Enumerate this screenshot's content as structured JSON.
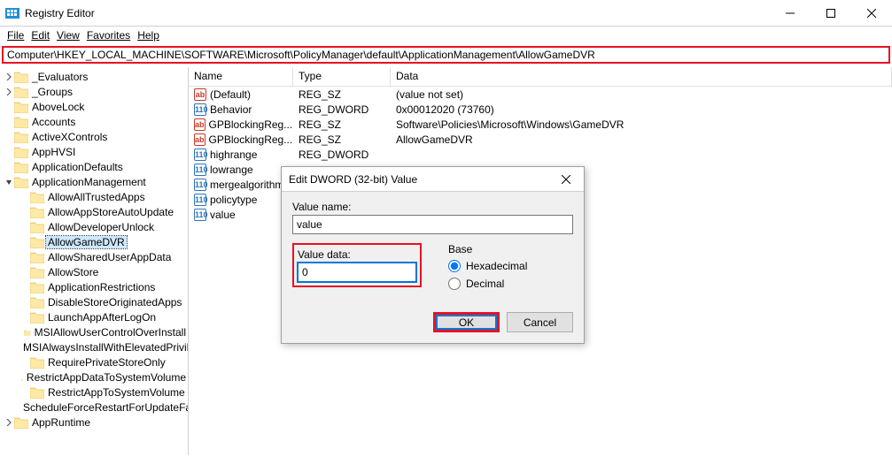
{
  "window": {
    "title": "Registry Editor"
  },
  "menu": {
    "file": "File",
    "edit": "Edit",
    "view": "View",
    "favorites": "Favorites",
    "help": "Help"
  },
  "address": {
    "path": "Computer\\HKEY_LOCAL_MACHINE\\SOFTWARE\\Microsoft\\PolicyManager\\default\\ApplicationManagement\\AllowGameDVR"
  },
  "tree": [
    {
      "indent": 0,
      "expander": ">",
      "label": "_Evaluators"
    },
    {
      "indent": 0,
      "expander": ">",
      "label": "_Groups"
    },
    {
      "indent": 0,
      "expander": "",
      "label": "AboveLock"
    },
    {
      "indent": 0,
      "expander": "",
      "label": "Accounts"
    },
    {
      "indent": 0,
      "expander": "",
      "label": "ActiveXControls"
    },
    {
      "indent": 0,
      "expander": "",
      "label": "AppHVSI"
    },
    {
      "indent": 0,
      "expander": "",
      "label": "ApplicationDefaults"
    },
    {
      "indent": 0,
      "expander": "v",
      "label": "ApplicationManagement"
    },
    {
      "indent": 1,
      "expander": "",
      "label": "AllowAllTrustedApps"
    },
    {
      "indent": 1,
      "expander": "",
      "label": "AllowAppStoreAutoUpdate"
    },
    {
      "indent": 1,
      "expander": "",
      "label": "AllowDeveloperUnlock"
    },
    {
      "indent": 1,
      "expander": "",
      "label": "AllowGameDVR",
      "selected": true
    },
    {
      "indent": 1,
      "expander": "",
      "label": "AllowSharedUserAppData"
    },
    {
      "indent": 1,
      "expander": "",
      "label": "AllowStore"
    },
    {
      "indent": 1,
      "expander": "",
      "label": "ApplicationRestrictions"
    },
    {
      "indent": 1,
      "expander": "",
      "label": "DisableStoreOriginatedApps"
    },
    {
      "indent": 1,
      "expander": "",
      "label": "LaunchAppAfterLogOn"
    },
    {
      "indent": 1,
      "expander": "",
      "label": "MSIAllowUserControlOverInstall"
    },
    {
      "indent": 1,
      "expander": "",
      "label": "MSIAlwaysInstallWithElevatedPrivileges"
    },
    {
      "indent": 1,
      "expander": "",
      "label": "RequirePrivateStoreOnly"
    },
    {
      "indent": 1,
      "expander": "",
      "label": "RestrictAppDataToSystemVolume"
    },
    {
      "indent": 1,
      "expander": "",
      "label": "RestrictAppToSystemVolume"
    },
    {
      "indent": 1,
      "expander": "",
      "label": "ScheduleForceRestartForUpdateFailures"
    },
    {
      "indent": 0,
      "expander": ">",
      "label": "AppRuntime"
    }
  ],
  "columns": {
    "name": "Name",
    "type": "Type",
    "data": "Data"
  },
  "rows": [
    {
      "icon": "sz",
      "name": "(Default)",
      "type": "REG_SZ",
      "data": "(value not set)"
    },
    {
      "icon": "dw",
      "name": "Behavior",
      "type": "REG_DWORD",
      "data": "0x00012020 (73760)"
    },
    {
      "icon": "sz",
      "name": "GPBlockingReg...",
      "type": "REG_SZ",
      "data": "Software\\Policies\\Microsoft\\Windows\\GameDVR"
    },
    {
      "icon": "sz",
      "name": "GPBlockingReg...",
      "type": "REG_SZ",
      "data": "AllowGameDVR"
    },
    {
      "icon": "dw",
      "name": "highrange",
      "type": "REG_DWORD",
      "data": ""
    },
    {
      "icon": "dw",
      "name": "lowrange",
      "type": "",
      "data": ""
    },
    {
      "icon": "dw",
      "name": "mergealgorithm",
      "type": "",
      "data": ""
    },
    {
      "icon": "dw",
      "name": "policytype",
      "type": "",
      "data": ""
    },
    {
      "icon": "dw",
      "name": "value",
      "type": "",
      "data": ""
    }
  ],
  "dialog": {
    "title": "Edit DWORD (32-bit) Value",
    "valueNameLabel": "Value name:",
    "valueName": "value",
    "valueDataLabel": "Value data:",
    "valueData": "0",
    "baseLabel": "Base",
    "hex": "Hexadecimal",
    "dec": "Decimal",
    "ok": "OK",
    "cancel": "Cancel"
  }
}
